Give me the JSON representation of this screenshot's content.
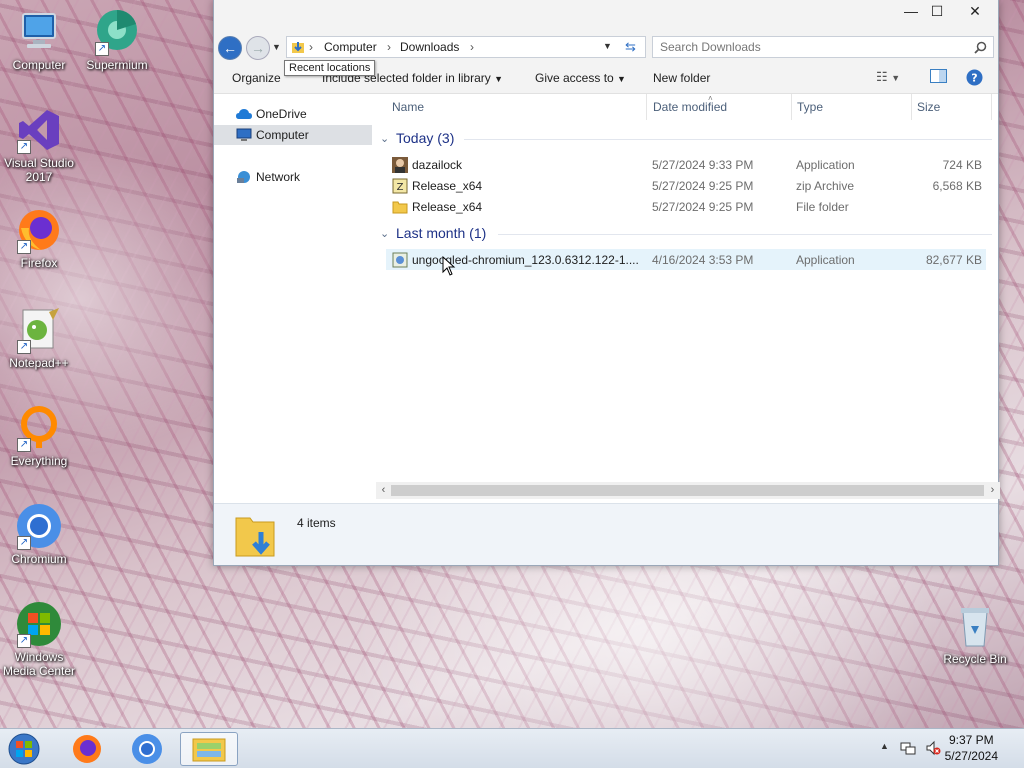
{
  "desktop": {
    "icons": [
      {
        "label": "Computer"
      },
      {
        "label": "Supermium"
      },
      {
        "label": "Visual Studio 2017"
      },
      {
        "label": "Firefox"
      },
      {
        "label": "Notepad++"
      },
      {
        "label": "Everything"
      },
      {
        "label": "Chromium"
      },
      {
        "label": "Windows Media Center"
      },
      {
        "label": "Recycle Bin"
      }
    ]
  },
  "explorer": {
    "breadcrumb": [
      "Computer",
      "Downloads"
    ],
    "search_placeholder": "Search Downloads",
    "tooltip": "Recent locations",
    "toolbar": {
      "organize": "Organize",
      "include_library": "Include selected folder in library",
      "give_access": "Give access to",
      "new_folder": "New folder"
    },
    "nav": {
      "onedrive": "OneDrive",
      "computer": "Computer",
      "network": "Network"
    },
    "columns": {
      "name": "Name",
      "date": "Date modified",
      "type": "Type",
      "size": "Size"
    },
    "groups": [
      {
        "label": "Today (3)",
        "files": [
          {
            "name": "dazailock",
            "date": "5/27/2024 9:33 PM",
            "type": "Application",
            "size": "724 KB"
          },
          {
            "name": "Release_x64",
            "date": "5/27/2024 9:25 PM",
            "type": "zip Archive",
            "size": "6,568 KB"
          },
          {
            "name": "Release_x64",
            "date": "5/27/2024 9:25 PM",
            "type": "File folder",
            "size": ""
          }
        ]
      },
      {
        "label": "Last month (1)",
        "files": [
          {
            "name": "ungoogled-chromium_123.0.6312.122-1....",
            "date": "4/16/2024 3:53 PM",
            "type": "Application",
            "size": "82,677 KB"
          }
        ]
      }
    ],
    "status": "4 items"
  },
  "taskbar": {
    "time": "9:37 PM",
    "date": "5/27/2024"
  },
  "colors": {
    "accent": "#1e3287",
    "selection": "#dde0e4",
    "hover": "#e5f3fb"
  }
}
